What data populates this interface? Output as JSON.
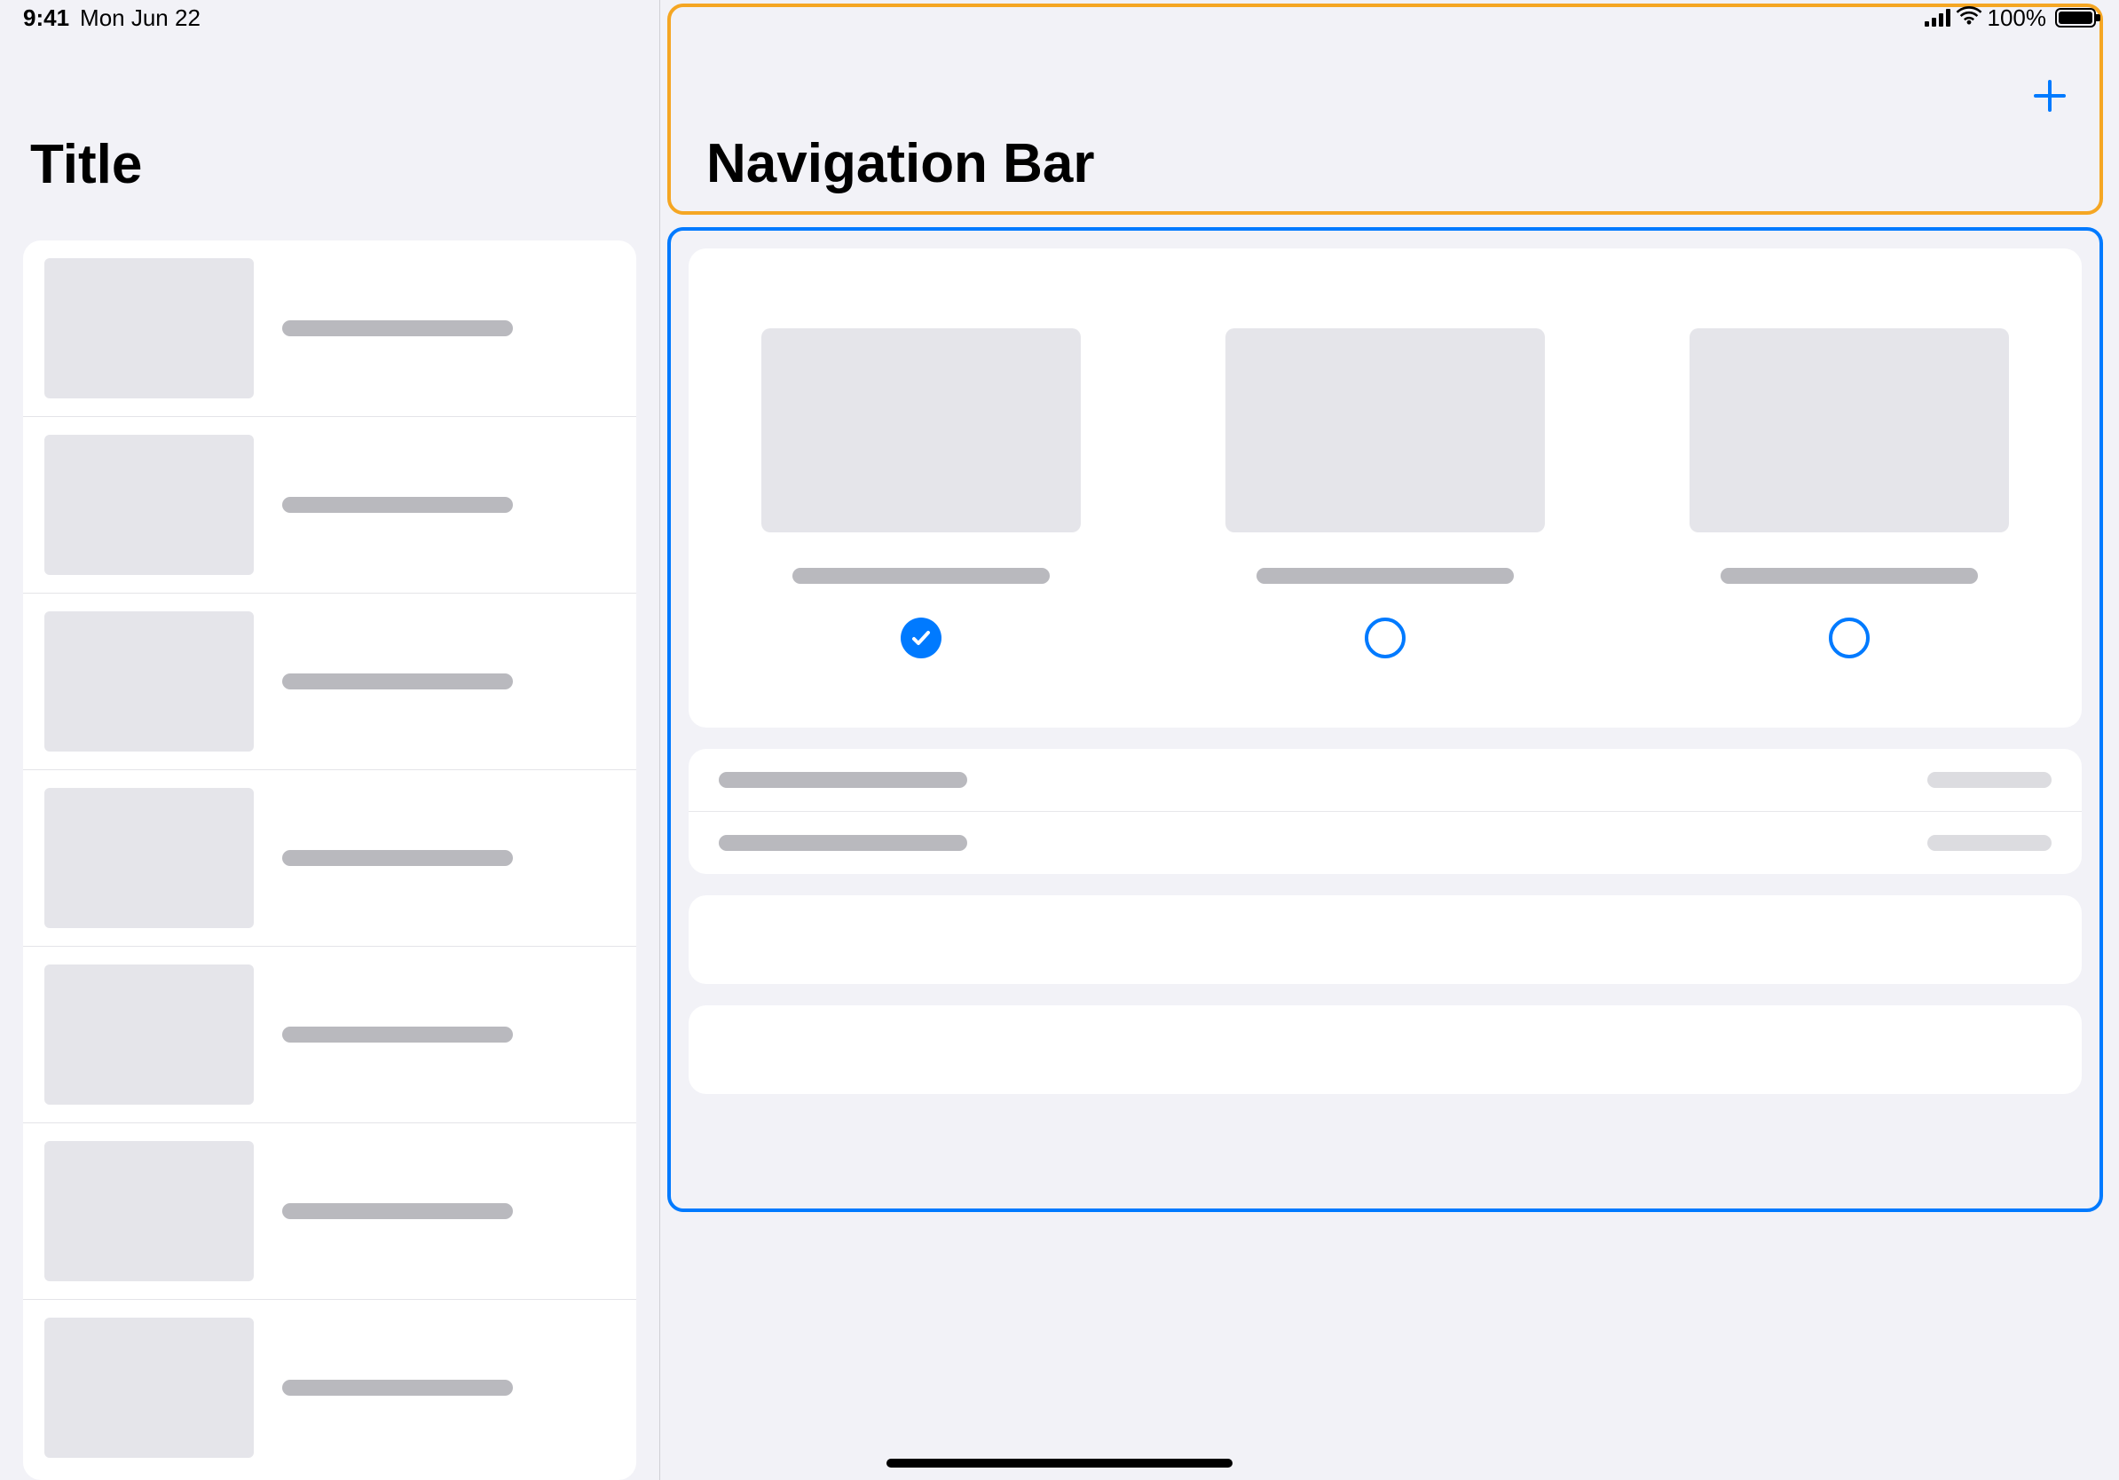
{
  "status_bar": {
    "time": "9:41",
    "date": "Mon Jun 22",
    "battery_pct": "100%"
  },
  "sidebar": {
    "title": "Title",
    "rows": 7
  },
  "main": {
    "nav_title": "Navigation Bar",
    "options": [
      {
        "selected": true
      },
      {
        "selected": false
      },
      {
        "selected": false
      }
    ]
  },
  "colors": {
    "accent": "#007aff",
    "highlight": "#f5a623",
    "placeholder": "#b9b9be",
    "placeholder_light": "#dcdce0",
    "surface": "#e5e5ea",
    "background": "#f2f2f7"
  }
}
